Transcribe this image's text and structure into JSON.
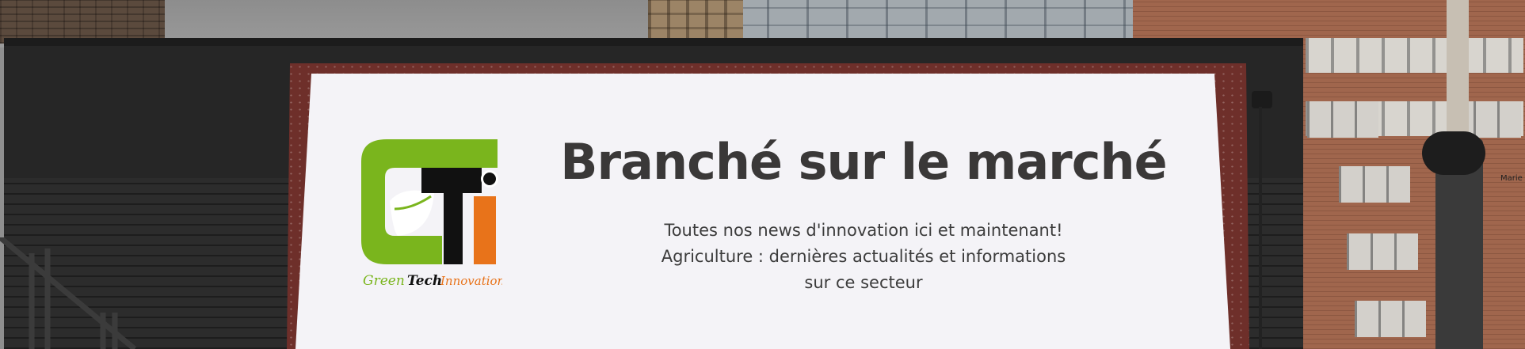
{
  "billboard": {
    "headline": "Branché sur le marché",
    "subtitle_lines": [
      "Toutes nos news d'innovation ici et maintenant!",
      "Agriculture : dernières actualités et informations",
      "sur ce secteur"
    ]
  },
  "logo": {
    "letters": "GTi",
    "tagline": {
      "word1": "Green",
      "word2": "Tech",
      "word3": "Innovation"
    },
    "colors": {
      "green": "#7ab51d",
      "black": "#111111",
      "orange": "#e8731a"
    }
  },
  "background_sign": "Marie"
}
